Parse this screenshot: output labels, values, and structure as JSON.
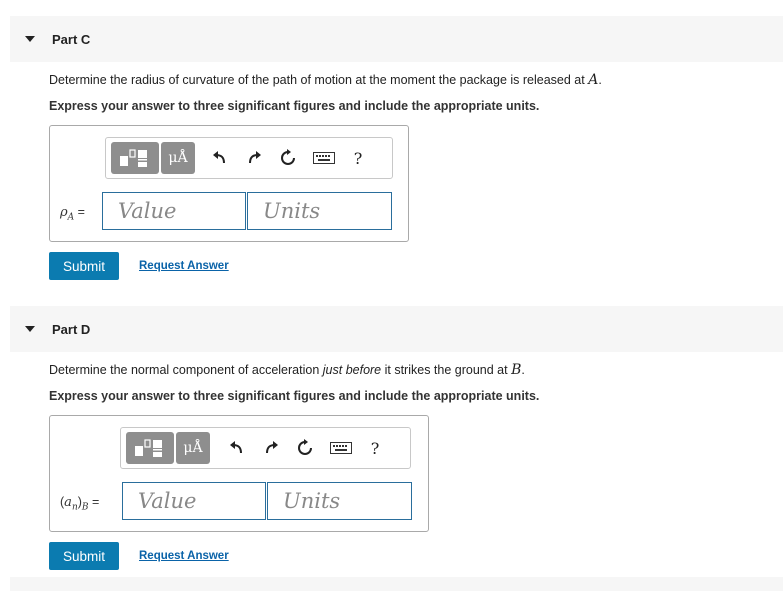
{
  "part_c": {
    "title": "Part C",
    "question_text": "Determine the radius of curvature of the path of motion at the moment the package is released at ",
    "question_var": "A",
    "question_end": ".",
    "instruction": "Express your answer to three significant figures and include the appropriate units.",
    "toolbar": {
      "units_label": "μÅ",
      "help_label": "?"
    },
    "input_label_var": "ρ",
    "input_label_sub": "A",
    "input_label_eq": " =",
    "value_placeholder": "Value",
    "units_placeholder": "Units",
    "submit_label": "Submit",
    "request_label": "Request Answer"
  },
  "part_d": {
    "title": "Part D",
    "question_text": "Determine the normal component of acceleration ",
    "question_italic": "just before",
    "question_text2": " it strikes the ground at ",
    "question_var": "B",
    "question_end": ".",
    "instruction": "Express your answer to three significant figures and include the appropriate units.",
    "toolbar": {
      "units_label": "μÅ",
      "help_label": "?"
    },
    "input_label_open": "(",
    "input_label_var": "a",
    "input_label_var_sub": "n",
    "input_label_close": ")",
    "input_label_sub": "B",
    "input_label_eq": " =",
    "value_placeholder": "Value",
    "units_placeholder": "Units",
    "submit_label": "Submit",
    "request_label": "Request Answer"
  },
  "icons": {
    "template": "template-icon",
    "undo": "undo-icon",
    "redo": "redo-icon",
    "reset": "reset-icon",
    "keyboard": "keyboard-icon"
  }
}
